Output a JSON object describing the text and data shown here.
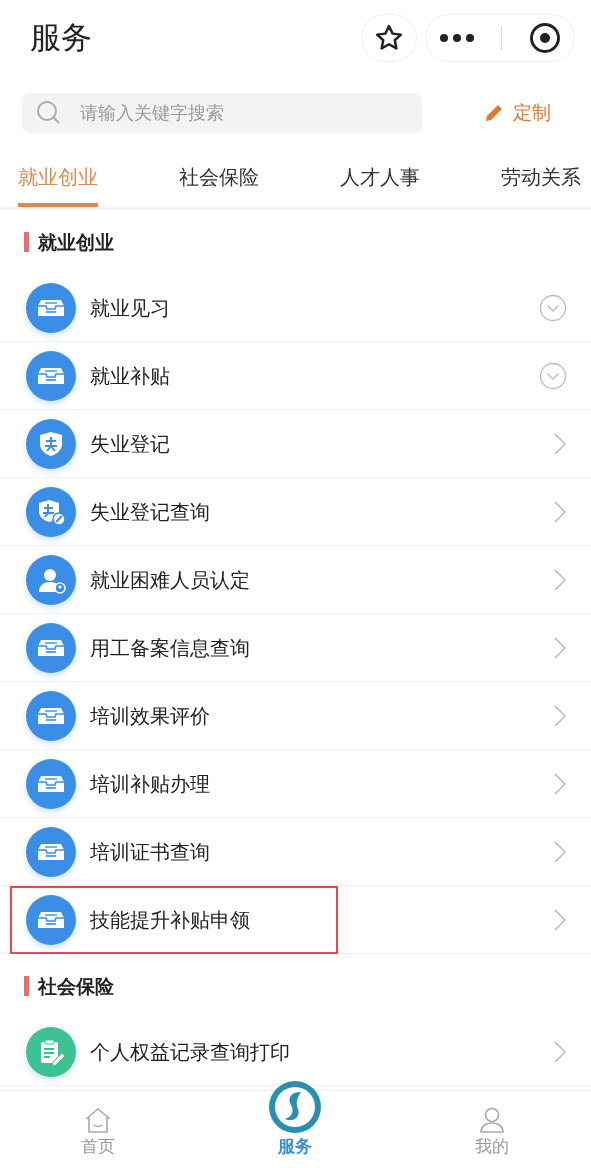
{
  "header": {
    "title": "服务"
  },
  "search": {
    "placeholder": "请输入关键字搜索"
  },
  "customize_button": {
    "label": "定制"
  },
  "tabs": [
    {
      "label": "就业创业",
      "selected": true
    },
    {
      "label": "社会保险",
      "selected": false
    },
    {
      "label": "人才人事",
      "selected": false
    },
    {
      "label": "劳动关系",
      "selected": false
    }
  ],
  "sections": [
    {
      "title": "就业创业",
      "items": [
        {
          "label": "就业见习",
          "kind": "tray",
          "expandable": true,
          "highlighted": false
        },
        {
          "label": "就业补贴",
          "kind": "tray",
          "expandable": true,
          "highlighted": false
        },
        {
          "label": "失业登记",
          "kind": "shield",
          "expandable": false,
          "highlighted": false
        },
        {
          "label": "失业登记查询",
          "kind": "shield-edit",
          "expandable": false,
          "highlighted": false
        },
        {
          "label": "就业困难人员认定",
          "kind": "person",
          "expandable": false,
          "highlighted": false
        },
        {
          "label": "用工备案信息查询",
          "kind": "tray",
          "expandable": false,
          "highlighted": false
        },
        {
          "label": "培训效果评价",
          "kind": "tray",
          "expandable": false,
          "highlighted": false
        },
        {
          "label": "培训补贴办理",
          "kind": "tray",
          "expandable": false,
          "highlighted": false
        },
        {
          "label": "培训证书查询",
          "kind": "tray",
          "expandable": false,
          "highlighted": false
        },
        {
          "label": "技能提升补贴申领",
          "kind": "tray",
          "expandable": false,
          "highlighted": true
        }
      ]
    },
    {
      "title": "社会保险",
      "items": [
        {
          "label": "个人权益记录查询打印",
          "kind": "clipboard",
          "expandable": false,
          "highlighted": false
        }
      ]
    }
  ],
  "bottom_nav": [
    {
      "label": "首页",
      "selected": false
    },
    {
      "label": "服务",
      "selected": true
    },
    {
      "label": "我的",
      "selected": false
    }
  ]
}
